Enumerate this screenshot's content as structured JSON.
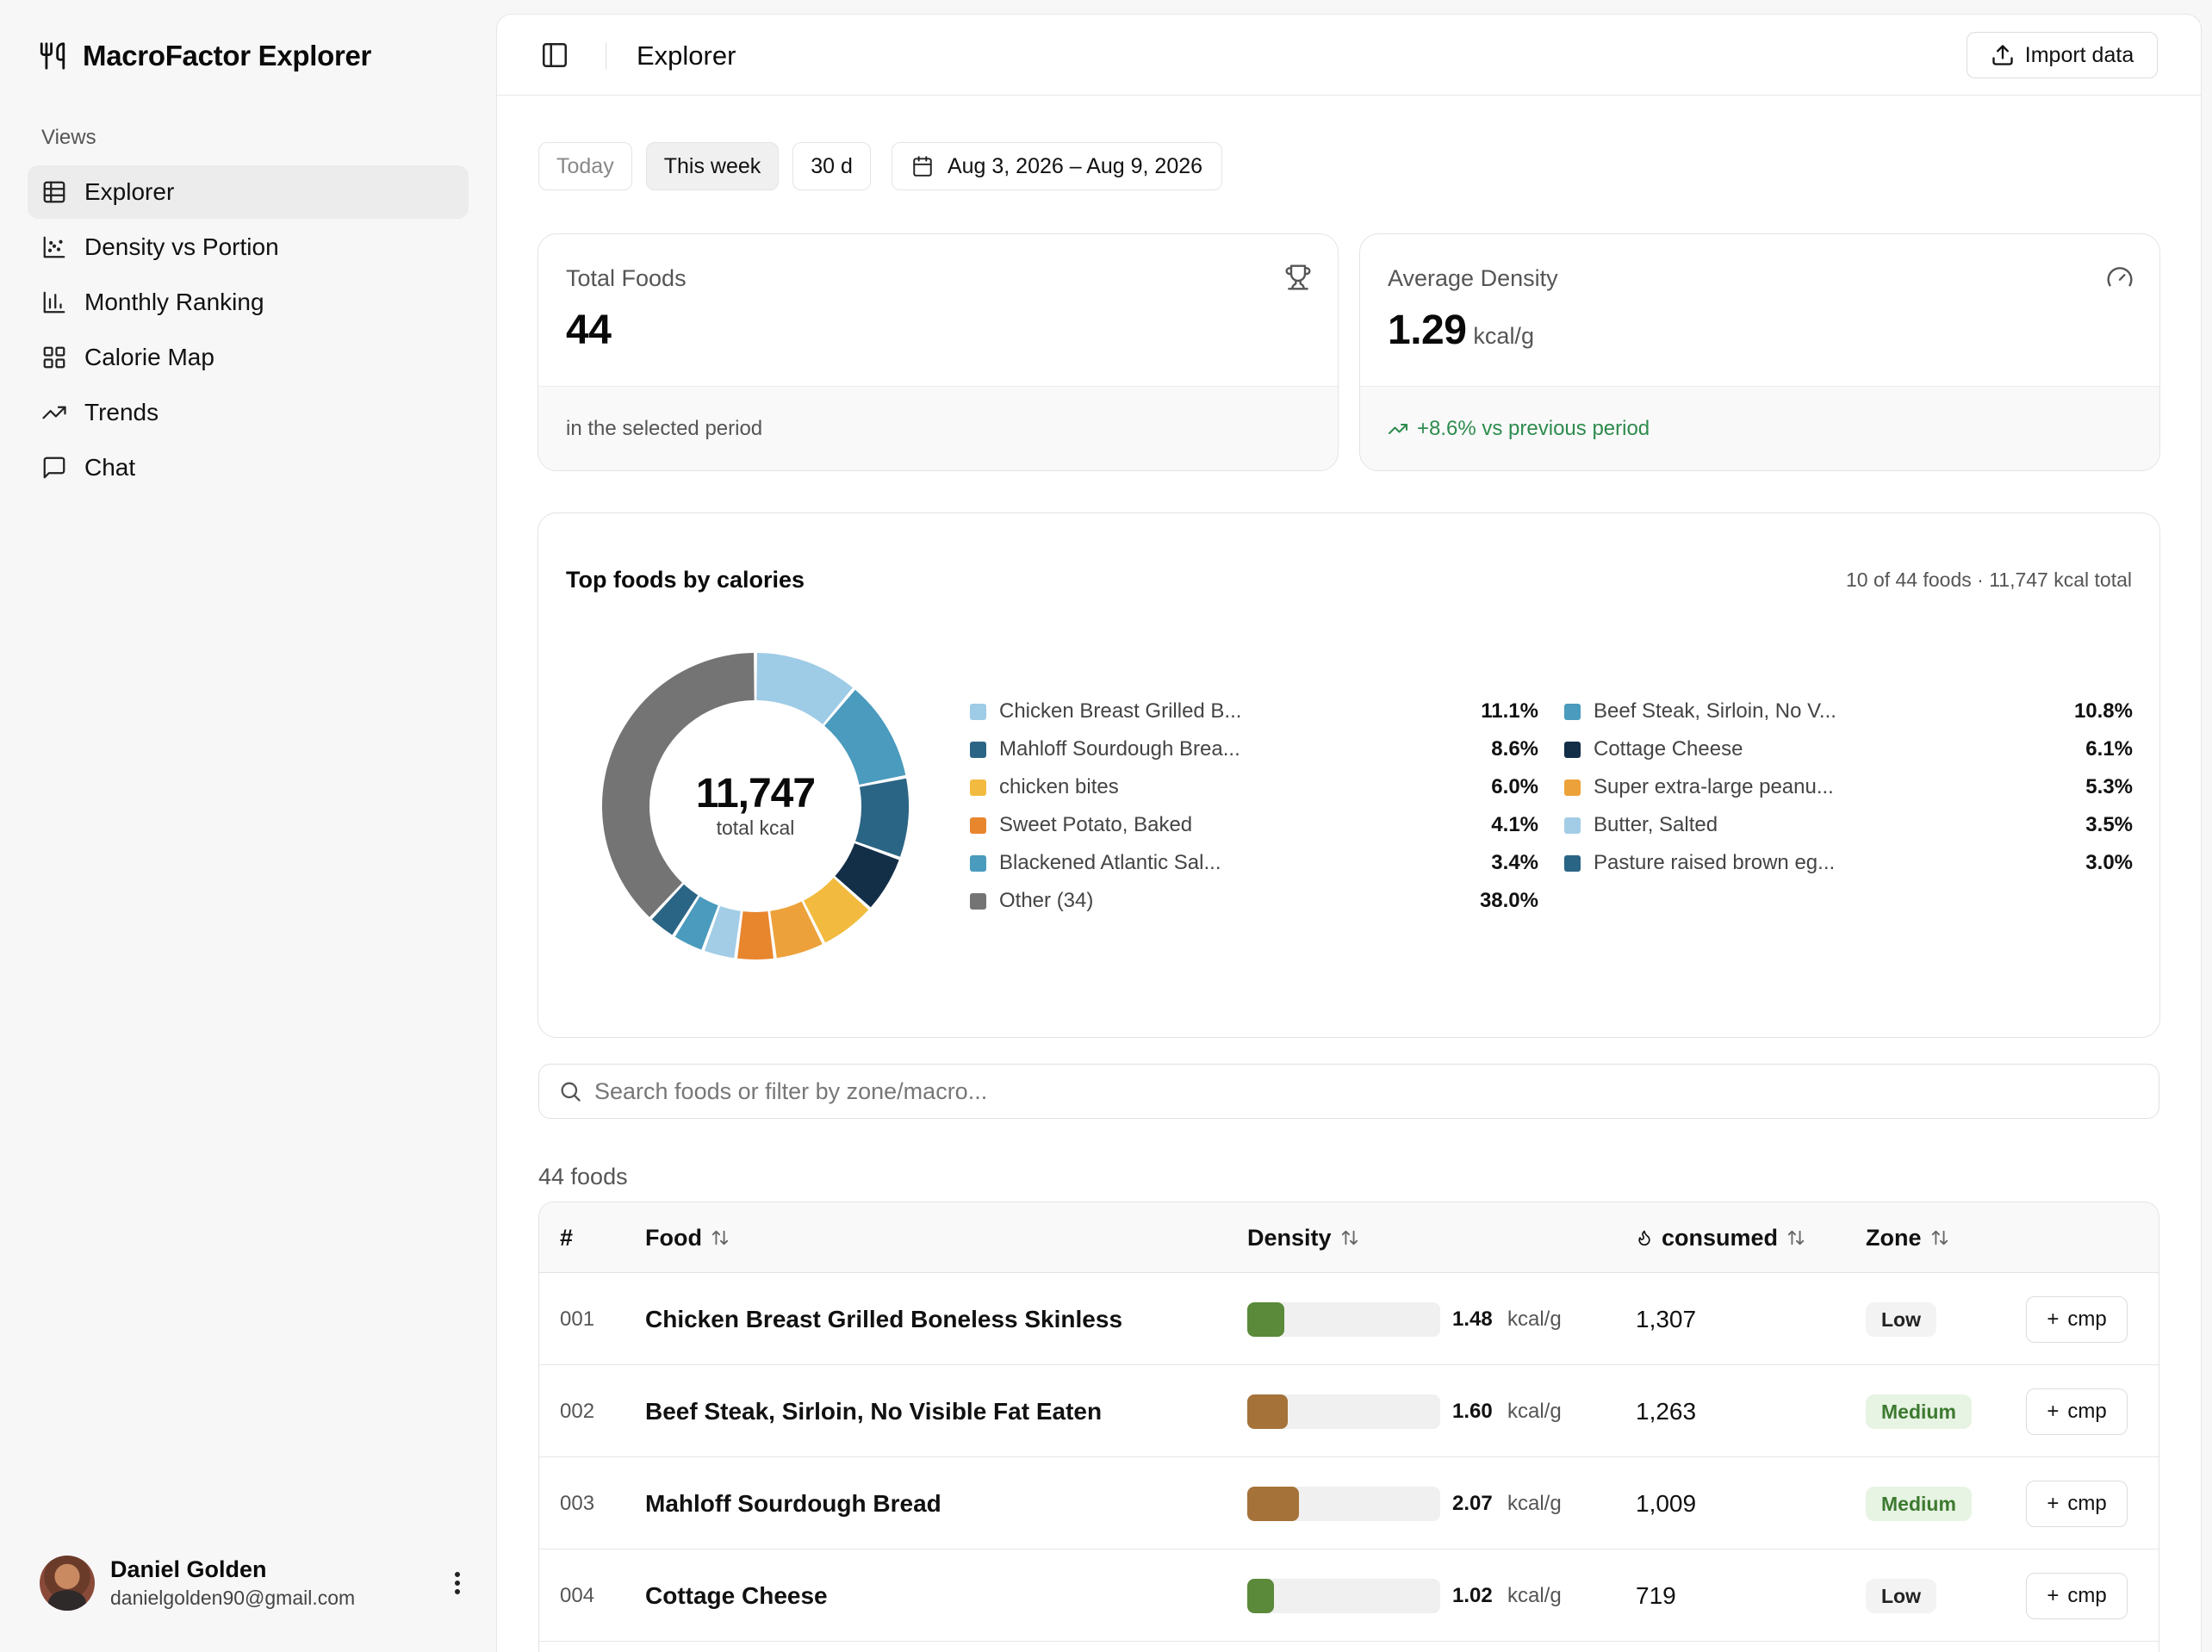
{
  "app": {
    "title": "MacroFactor Explorer"
  },
  "sidebar": {
    "section_label": "Views",
    "items": [
      {
        "label": "Explorer",
        "icon": "table-icon",
        "active": true
      },
      {
        "label": "Density vs Portion",
        "icon": "scatter-chart-icon",
        "active": false
      },
      {
        "label": "Monthly Ranking",
        "icon": "bar-chart-icon",
        "active": false
      },
      {
        "label": "Calorie Map",
        "icon": "grid-icon",
        "active": false
      },
      {
        "label": "Trends",
        "icon": "trend-up-icon",
        "active": false
      },
      {
        "label": "Chat",
        "icon": "chat-bubble-icon",
        "active": false
      }
    ],
    "user": {
      "name": "Daniel Golden",
      "email": "danielgolden90@gmail.com"
    }
  },
  "header": {
    "title": "Explorer",
    "import_label": "Import data"
  },
  "range": {
    "options": [
      "Today",
      "This week",
      "30 d"
    ],
    "selected": "This week",
    "date_range": "Aug 3, 2026 – Aug 9, 2026"
  },
  "stats": {
    "total_foods": {
      "label": "Total Foods",
      "value": "44",
      "footer": "in the selected period"
    },
    "avg_density": {
      "label": "Average Density",
      "value": "1.29",
      "unit": "kcal/g",
      "footer": "+8.6% vs previous period"
    }
  },
  "chart": {
    "title": "Top foods by calories",
    "summary": "10 of 44 foods · 11,747 kcal total",
    "center_value": "11,747",
    "center_label": "total kcal"
  },
  "chart_data": {
    "type": "pie",
    "title": "Top foods by calories",
    "total_kcal": 11747,
    "slices": [
      {
        "name": "Chicken Breast Grilled B...",
        "percent": 11.1,
        "display": "11.1%",
        "color": "#9ecbe6"
      },
      {
        "name": "Beef Steak, Sirloin, No V...",
        "percent": 10.8,
        "display": "10.8%",
        "color": "#4a9bbd"
      },
      {
        "name": "Mahloff Sourdough Brea...",
        "percent": 8.6,
        "display": "8.6%",
        "color": "#2b6585"
      },
      {
        "name": "Cottage Cheese",
        "percent": 6.1,
        "display": "6.1%",
        "color": "#132e47"
      },
      {
        "name": "chicken bites",
        "percent": 6.0,
        "display": "6.0%",
        "color": "#f2bb3f"
      },
      {
        "name": "Super extra-large peanu...",
        "percent": 5.3,
        "display": "5.3%",
        "color": "#eda13a"
      },
      {
        "name": "Sweet Potato, Baked",
        "percent": 4.1,
        "display": "4.1%",
        "color": "#e8862e"
      },
      {
        "name": "Butter, Salted",
        "percent": 3.5,
        "display": "3.5%",
        "color": "#a3cde6"
      },
      {
        "name": "Blackened Atlantic Sal...",
        "percent": 3.4,
        "display": "3.4%",
        "color": "#4a9bbd"
      },
      {
        "name": "Pasture raised brown eg...",
        "percent": 3.0,
        "display": "3.0%",
        "color": "#2b6585"
      },
      {
        "name": "Other (34)",
        "percent": 38.0,
        "display": "38.0%",
        "color": "#747474"
      }
    ]
  },
  "search": {
    "placeholder": "Search foods or filter by zone/macro..."
  },
  "table": {
    "count_label": "44 foods",
    "columns": {
      "num": "#",
      "food": "Food",
      "density": "Density",
      "consumed": "consumed",
      "zone": "Zone"
    },
    "density_unit": "kcal/g",
    "cmp_label": "cmp",
    "rows": [
      {
        "num": "001",
        "food": "Chicken Breast Grilled Boneless Skinless",
        "density": "1.48",
        "density_fraction": 0.19,
        "bar_color": "#5a8a3a",
        "consumed": "1,307",
        "zone": "Low"
      },
      {
        "num": "002",
        "food": "Beef Steak, Sirloin, No Visible Fat Eaten",
        "density": "1.60",
        "density_fraction": 0.21,
        "bar_color": "#a57239",
        "consumed": "1,263",
        "zone": "Medium"
      },
      {
        "num": "003",
        "food": "Mahloff Sourdough Bread",
        "density": "2.07",
        "density_fraction": 0.27,
        "bar_color": "#a57239",
        "consumed": "1,009",
        "zone": "Medium"
      },
      {
        "num": "004",
        "food": "Cottage Cheese",
        "density": "1.02",
        "density_fraction": 0.14,
        "bar_color": "#5a8a3a",
        "consumed": "719",
        "zone": "Low"
      }
    ]
  }
}
